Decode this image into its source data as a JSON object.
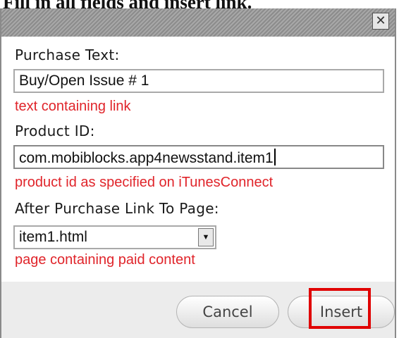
{
  "page_caption": "Fill in all fields and insert link.",
  "dialog": {
    "close_icon": "close-icon",
    "close_glyph": "✕"
  },
  "fields": {
    "purchase_text": {
      "label": "Purchase Text:",
      "value": "Buy/Open Issue # 1",
      "hint": "text containing link"
    },
    "product_id": {
      "label": "Product ID:",
      "value": "com.mobiblocks.app4newsstand.item1",
      "hint": "product id as specified on iTunesConnect"
    },
    "after_purchase": {
      "label": "After Purchase Link To Page:",
      "selected": "item1.html",
      "arrow_glyph": "▼",
      "hint": "page containing paid content"
    }
  },
  "buttons": {
    "cancel_label": "Cancel",
    "insert_label": "Insert"
  },
  "colors": {
    "hint": "#e0242a",
    "highlight": "#e00000"
  }
}
